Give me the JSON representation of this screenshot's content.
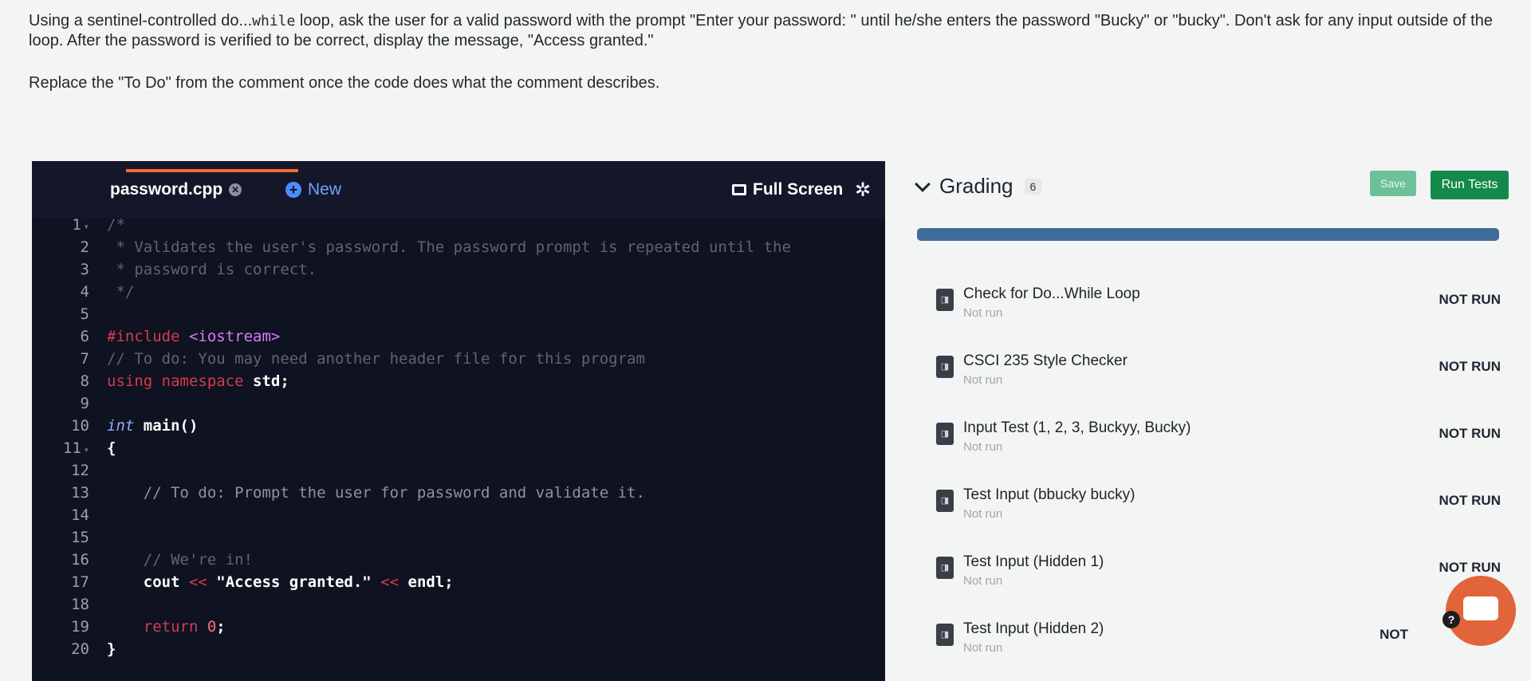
{
  "instructions": {
    "line1_pre": "Using a sentinel-controlled do...",
    "line1_code": "while",
    "line1_post": " loop, ask the user for a valid password with the prompt \"Enter your password: \" until he/she enters the password \"Bucky\" or \"bucky\". Don't ask for any input outside of the loop. After the password is verified to be correct, display the message, \"Access granted.\"",
    "line2": "Replace the \"To Do\" from the comment once the code does what the comment describes."
  },
  "editor": {
    "tab_file": "password.cpp",
    "tab_new": "New",
    "full_screen": "Full Screen",
    "lines": {
      "l1": "/*",
      "l2": " * Validates the user's password. The password prompt is repeated until the",
      "l3": " * password is correct.",
      "l4": " */",
      "l6_inc": "#include",
      "l6_hdr": " <iostream>",
      "l7": "// To do: You may need another header file for this program",
      "l8_kw": "using namespace",
      "l8_rest": " std;",
      "l10_type": "int",
      "l10_rest": " main()",
      "l11": "{",
      "l13": "    // To do: Prompt the user for password and validate it.",
      "l16": "    // We're in!",
      "l17_a": "    cout ",
      "l17_op1": "<<",
      "l17_str": " \"Access granted.\" ",
      "l17_op2": "<<",
      "l17_b": " endl;",
      "l19_kw": "    return",
      "l19_num": " 0",
      "l19_b": ";",
      "l20": "}"
    }
  },
  "grading": {
    "title": "Grading",
    "count": "6",
    "save_label": "Save",
    "run_label": "Run Tests",
    "tests": [
      {
        "name": "Check for Do...While Loop",
        "sub": "Not run",
        "status": "NOT RUN"
      },
      {
        "name": "CSCI 235 Style Checker",
        "sub": "Not run",
        "status": "NOT RUN"
      },
      {
        "name": "Input Test (1, 2, 3, Buckyy, Bucky)",
        "sub": "Not run",
        "status": "NOT RUN"
      },
      {
        "name": "Test Input (bbucky bucky)",
        "sub": "Not run",
        "status": "NOT RUN"
      },
      {
        "name": "Test Input (Hidden 1)",
        "sub": "Not run",
        "status": "NOT RUN"
      },
      {
        "name": "Test Input (Hidden 2)",
        "sub": "Not run",
        "status": "NOT"
      }
    ]
  },
  "help": {
    "badge": "?"
  }
}
